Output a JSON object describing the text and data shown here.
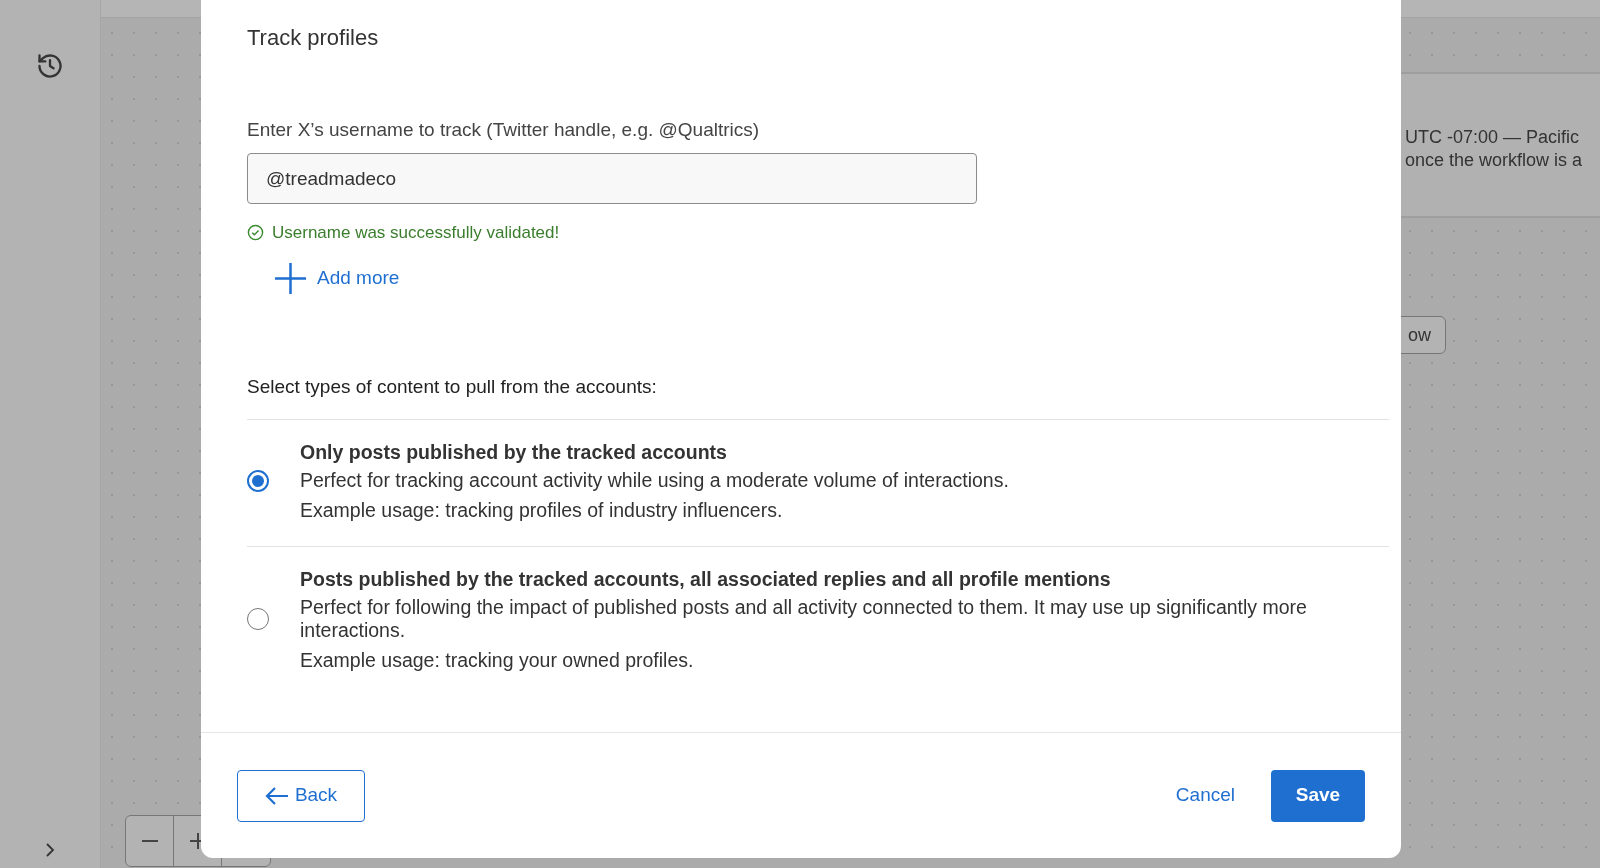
{
  "background": {
    "card_lines": [
      "UTC -07:00 — Pacific",
      "once the workflow is a"
    ],
    "button": "ow"
  },
  "modal": {
    "title": "Track profiles",
    "field": {
      "label": "Enter X’s username to track (Twitter handle, e.g. @Qualtrics)",
      "value": "@treadmadeco"
    },
    "validation": "Username was successfully validated!",
    "add_more": "Add more",
    "prompt": "Select types of content to pull from the accounts:",
    "options": [
      {
        "title": "Only posts published by the tracked accounts",
        "description": "Perfect for tracking account activity while using a moderate volume of interactions.",
        "example": "Example usage: tracking profiles of industry influencers.",
        "selected": true
      },
      {
        "title": "Posts published by the tracked accounts, all associated replies and all profile mentions",
        "description": "Perfect for following the impact of published posts and all activity connected to them. It may use up significantly more interactions.",
        "example": "Example usage: tracking your owned profiles.",
        "selected": false
      }
    ],
    "footer": {
      "back": "Back",
      "cancel": "Cancel",
      "save": "Save"
    }
  }
}
